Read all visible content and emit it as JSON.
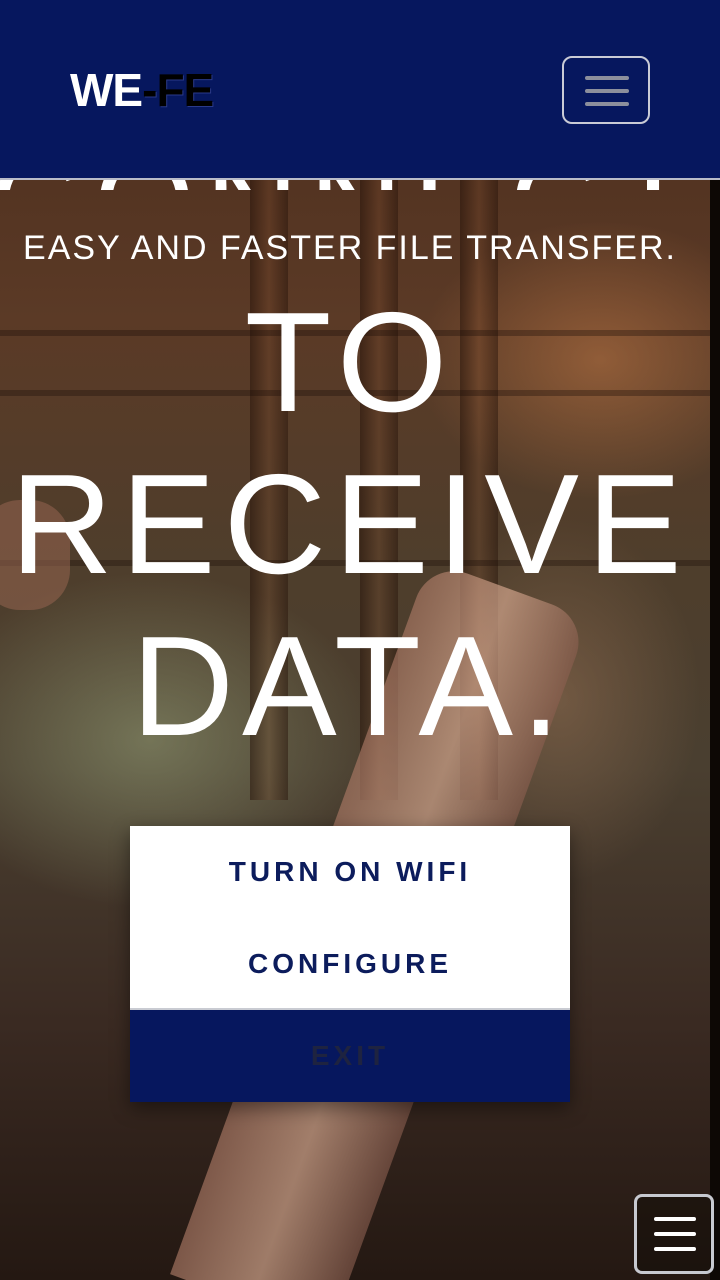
{
  "navbar": {
    "brand_part1": "WE",
    "brand_dash": "-",
    "brand_part2": "FE",
    "toggle_icon": "hamburger-menu-icon"
  },
  "hero": {
    "ghost_text": "CONNECT",
    "tagline": "EASY AND FASTER FILE TRANSFER.",
    "headline_lines": [
      "TO",
      "RECEIVE",
      "DATA."
    ]
  },
  "menu": {
    "items": [
      {
        "label": "TURN ON WIFI"
      },
      {
        "label": "CONFIGURE"
      },
      {
        "label": "EXIT"
      }
    ]
  },
  "floating_button": {
    "icon": "hamburger-menu-icon"
  },
  "colors": {
    "navbar_bg": "#06175e",
    "menu_text": "#0c1c5c",
    "menu_dark_bg": "#06175e"
  }
}
